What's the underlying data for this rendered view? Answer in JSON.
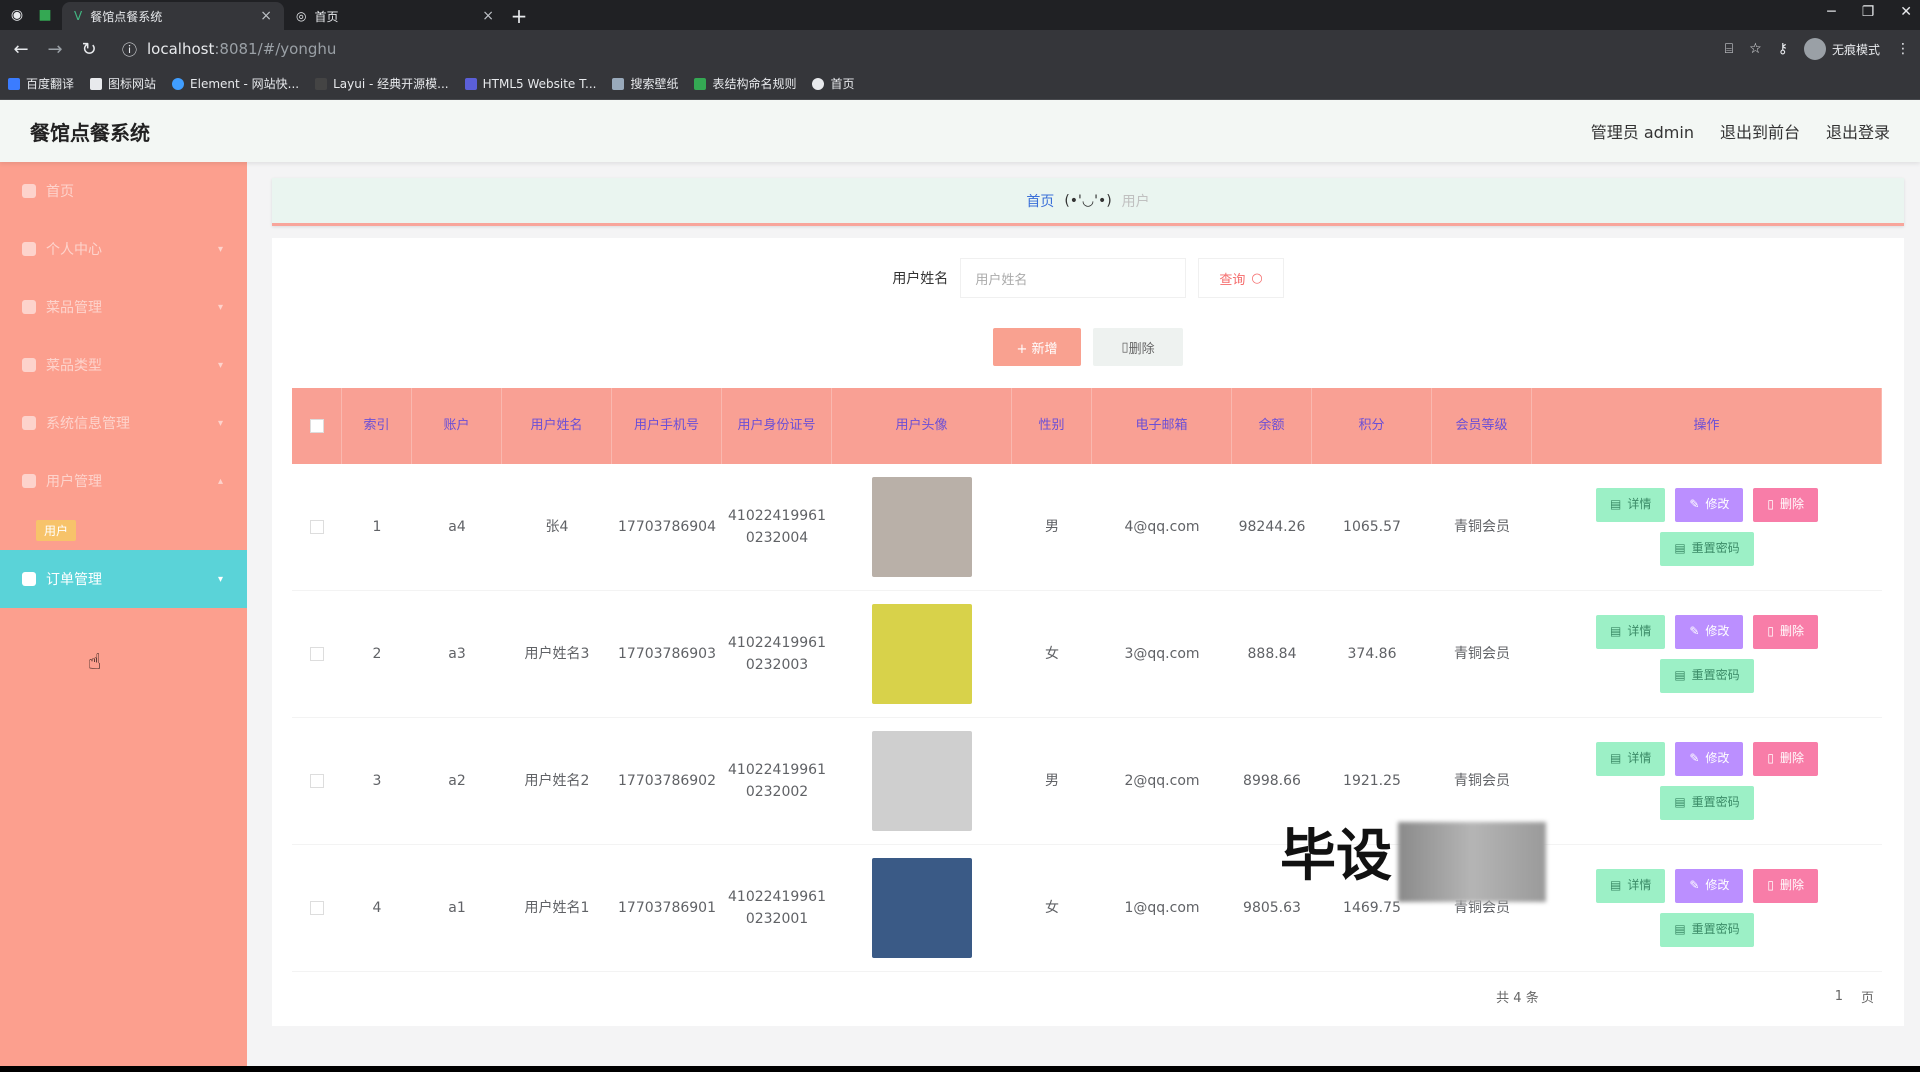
{
  "browser": {
    "tabs": [
      {
        "title": "餐馆点餐系统",
        "icon": "vue-icon",
        "close": "×"
      },
      {
        "title": "首页",
        "icon": "globe-icon",
        "close": "×"
      }
    ],
    "new_tab": "+",
    "url_host": "localhost",
    "url_path": ":8081/#/yonghu",
    "incognito_label": "无痕模式",
    "bookmarks": [
      "百度翻译",
      "图标网站",
      "Element - 网站快...",
      "Layui - 经典开源模...",
      "HTML5 Website T...",
      "搜索壁纸",
      "表结构命名规则",
      "首页"
    ]
  },
  "header": {
    "title": "餐馆点餐系统",
    "admin_label": "管理员 admin",
    "back_front": "退出到前台",
    "logout": "退出登录"
  },
  "sidebar": {
    "items": [
      {
        "label": "首页",
        "icon": "home-icon"
      },
      {
        "label": "个人中心",
        "icon": "user-icon"
      },
      {
        "label": "菜品管理",
        "icon": "list-icon"
      },
      {
        "label": "菜品类型",
        "icon": "list-icon"
      },
      {
        "label": "系统信息管理",
        "icon": "gear-icon"
      },
      {
        "label": "用户管理",
        "icon": "users-icon"
      },
      {
        "label": "用户",
        "icon": ""
      },
      {
        "label": "订单管理",
        "icon": "orders-icon"
      }
    ]
  },
  "breadcrumb": {
    "home": "首页",
    "emoticon": "(•'◡'•)",
    "current": "用户"
  },
  "search": {
    "label": "用户姓名",
    "placeholder": "用户姓名",
    "button": "查询"
  },
  "actions": {
    "add": "+ 新增",
    "delete": "删除"
  },
  "table": {
    "headers": [
      "索引",
      "账户",
      "用户姓名",
      "用户手机号",
      "用户身份证号",
      "用户头像",
      "性别",
      "电子邮箱",
      "余额",
      "积分",
      "会员等级",
      "操作"
    ],
    "rows": [
      {
        "index": "1",
        "account": "a4",
        "name": "张4",
        "phone": "17703786904",
        "idcard": "410224199610232004",
        "gender": "男",
        "email": "4@qq.com",
        "balance": "98244.26",
        "points": "1065.57",
        "level": "青铜会员",
        "avatar_color": "#b9b0a8"
      },
      {
        "index": "2",
        "account": "a3",
        "name": "用户姓名3",
        "phone": "17703786903",
        "idcard": "410224199610232003",
        "gender": "女",
        "email": "3@qq.com",
        "balance": "888.84",
        "points": "374.86",
        "level": "青铜会员",
        "avatar_color": "#d8d24a"
      },
      {
        "index": "3",
        "account": "a2",
        "name": "用户姓名2",
        "phone": "17703786902",
        "idcard": "410224199610232002",
        "gender": "男",
        "email": "2@qq.com",
        "balance": "8998.66",
        "points": "1921.25",
        "level": "青铜会员",
        "avatar_color": "#cfcfcf"
      },
      {
        "index": "4",
        "account": "a1",
        "name": "用户姓名1",
        "phone": "17703786901",
        "idcard": "410224199610232001",
        "gender": "女",
        "email": "1@qq.com",
        "balance": "9805.63",
        "points": "1469.75",
        "level": "青铜会员",
        "avatar_color": "#3a5a86"
      }
    ],
    "op_labels": {
      "detail": "详情",
      "edit": "修改",
      "remove": "删除",
      "reset": "重置密码"
    }
  },
  "pager": {
    "total": "共 4 条",
    "page": "1",
    "unit": "页"
  },
  "watermark": "毕设",
  "colors": {
    "sidebar": "#fc9f8e",
    "active": "#5ad3d8",
    "thead": "#f9a094",
    "add": "#f9a190"
  }
}
